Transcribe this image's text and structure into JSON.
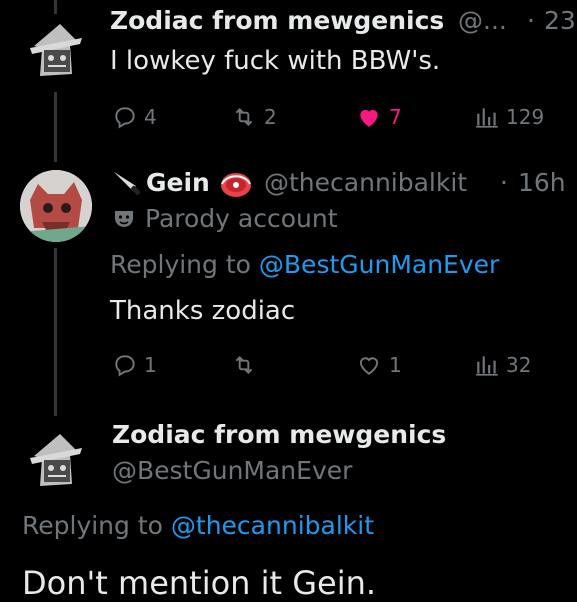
{
  "tweet1": {
    "author_name": "Zodiac from mewgenics",
    "handle": "@...",
    "separator": "·",
    "time": "23",
    "text": "I lowkey fuck with BBW's.",
    "replies": "4",
    "retweets": "2",
    "likes": "7",
    "views": "129",
    "liked_color": "#f91880"
  },
  "tweet2": {
    "author_name": "Gein",
    "handle": "@thecannibalkit",
    "separator": "·",
    "time": "16h",
    "badge": "Parody account",
    "replying_prefix": "Replying to",
    "replying_handle": "@BestGunManEver",
    "text": "Thanks zodiac",
    "replies": "1",
    "retweets": "",
    "likes": "1",
    "views": "32"
  },
  "tweet3": {
    "author_name": "Zodiac from mewgenics",
    "handle": "@BestGunManEver",
    "replying_prefix": "Replying to",
    "replying_handle": "@thecannibalkit",
    "text": "Don't mention it Gein."
  },
  "colors": {
    "background": "#000000",
    "text": "#e7e9ea",
    "muted": "#71767b",
    "link": "#1d9bf0",
    "like": "#f91880"
  },
  "icons": [
    "reply-icon",
    "retweet-icon",
    "like-icon",
    "views-icon",
    "knife-emoji-icon",
    "meat-emoji-icon",
    "parody-mask-icon"
  ]
}
